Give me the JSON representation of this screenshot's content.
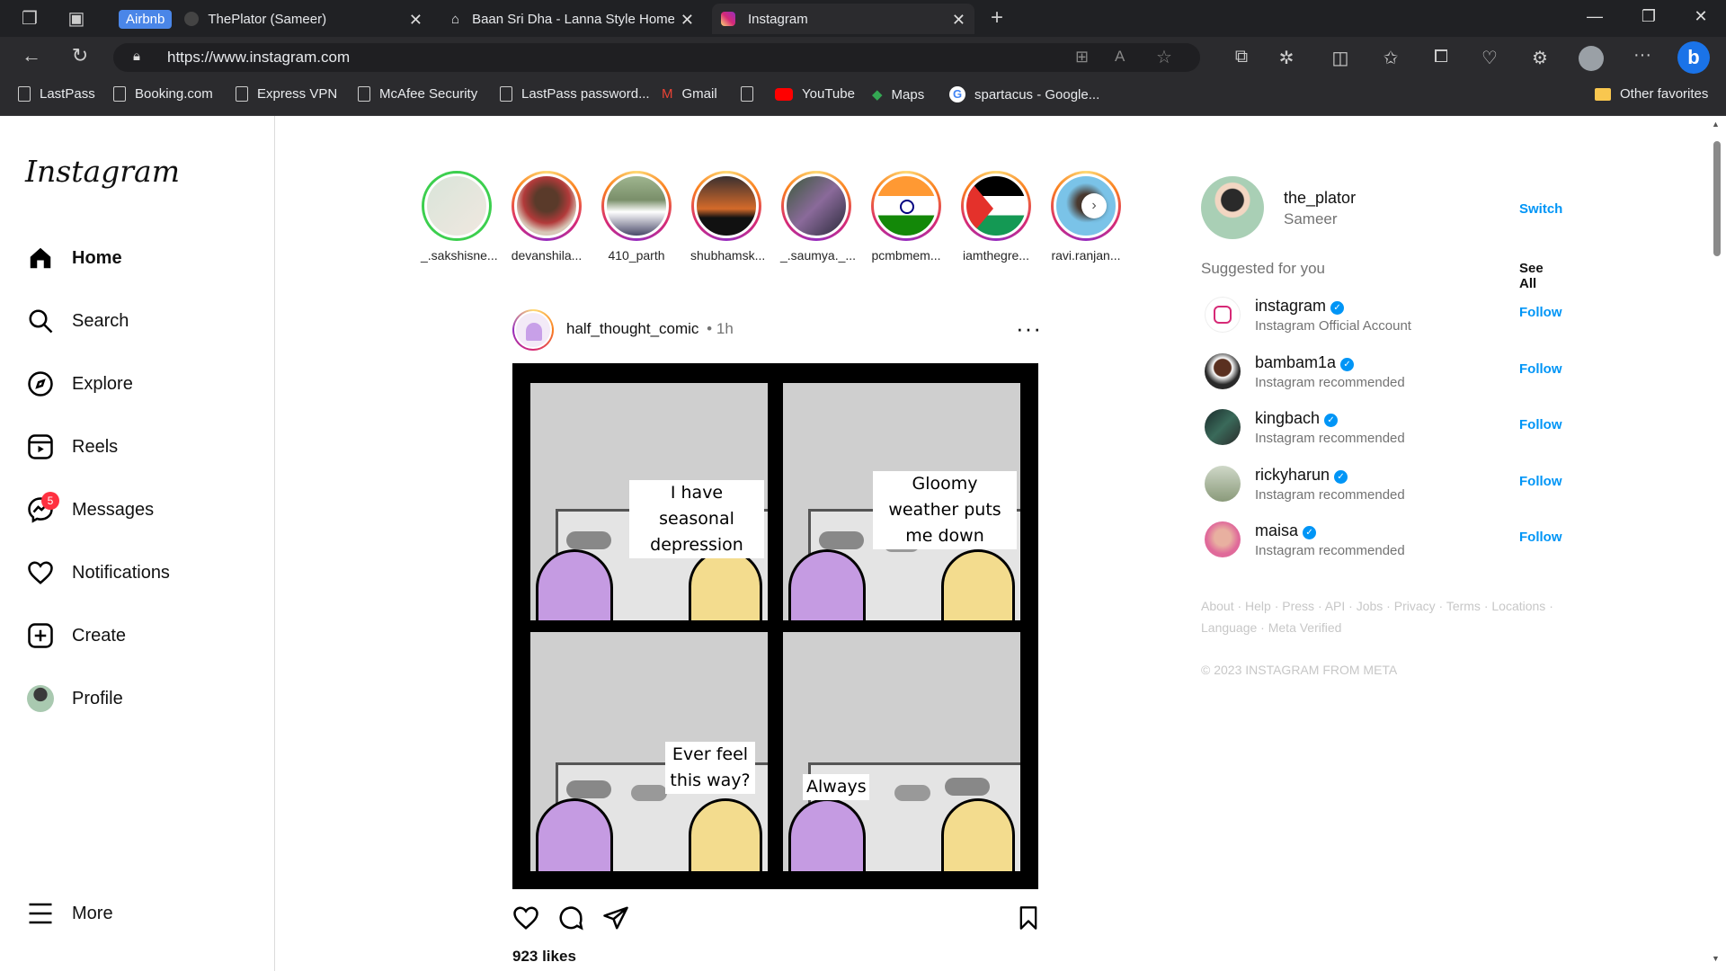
{
  "browser": {
    "tabs": [
      {
        "badge": "Airbnb",
        "title": "ThePlator (Sameer)"
      },
      {
        "title": "Baan Sri Dha - Lanna Style Home"
      },
      {
        "title": "Instagram"
      }
    ],
    "url": "https://www.instagram.com",
    "bookmarks": [
      "LastPass",
      "Booking.com",
      "Express VPN",
      "McAfee Security",
      "LastPass password...",
      "Gmail",
      "",
      "YouTube",
      "Maps",
      "spartacus - Google..."
    ],
    "other_favorites": "Other favorites"
  },
  "sidebar": {
    "logo": "Instagram",
    "items": [
      {
        "label": "Home",
        "icon": "home-icon"
      },
      {
        "label": "Search",
        "icon": "search-icon"
      },
      {
        "label": "Explore",
        "icon": "compass-icon"
      },
      {
        "label": "Reels",
        "icon": "reels-icon"
      },
      {
        "label": "Messages",
        "icon": "messenger-icon"
      },
      {
        "label": "Notifications",
        "icon": "heart-icon"
      },
      {
        "label": "Create",
        "icon": "plus-square-icon"
      },
      {
        "label": "Profile",
        "icon": "avatar"
      }
    ],
    "messages_badge": "5",
    "more": "More"
  },
  "stories": [
    "_.sakshisne...",
    "devanshila...",
    "410_parth",
    "shubhamsk...",
    "_.saumya._...",
    "pcmbmem...",
    "iamthegre...",
    "ravi.ranjan..."
  ],
  "post": {
    "username": "half_thought_comic",
    "time": "1h",
    "time_separator": "•",
    "panels": [
      {
        "text": "I have seasonal depression"
      },
      {
        "text": "Gloomy weather puts me down"
      },
      {
        "text": "Ever feel this way?"
      },
      {
        "text": "Always"
      }
    ],
    "likes": "923 likes"
  },
  "right": {
    "username": "the_plator",
    "name": "Sameer",
    "switch": "Switch",
    "suggested_title": "Suggested for you",
    "see_all": "See All",
    "suggestions": [
      {
        "username": "instagram",
        "sub": "Instagram Official Account"
      },
      {
        "username": "bambam1a",
        "sub": "Instagram recommended"
      },
      {
        "username": "kingbach",
        "sub": "Instagram recommended"
      },
      {
        "username": "rickyharun",
        "sub": "Instagram recommended"
      },
      {
        "username": "maisa",
        "sub": "Instagram recommended"
      }
    ],
    "follow": "Follow",
    "footer_line1": "About · Help · Press · API · Jobs · Privacy · Terms · Locations ·",
    "footer_line2": "Language · Meta Verified",
    "copyright": "© 2023 INSTAGRAM FROM META"
  },
  "colors": {
    "accent": "#0095f6",
    "chrome": "#2b2b2e",
    "badge": "#ff3040"
  }
}
